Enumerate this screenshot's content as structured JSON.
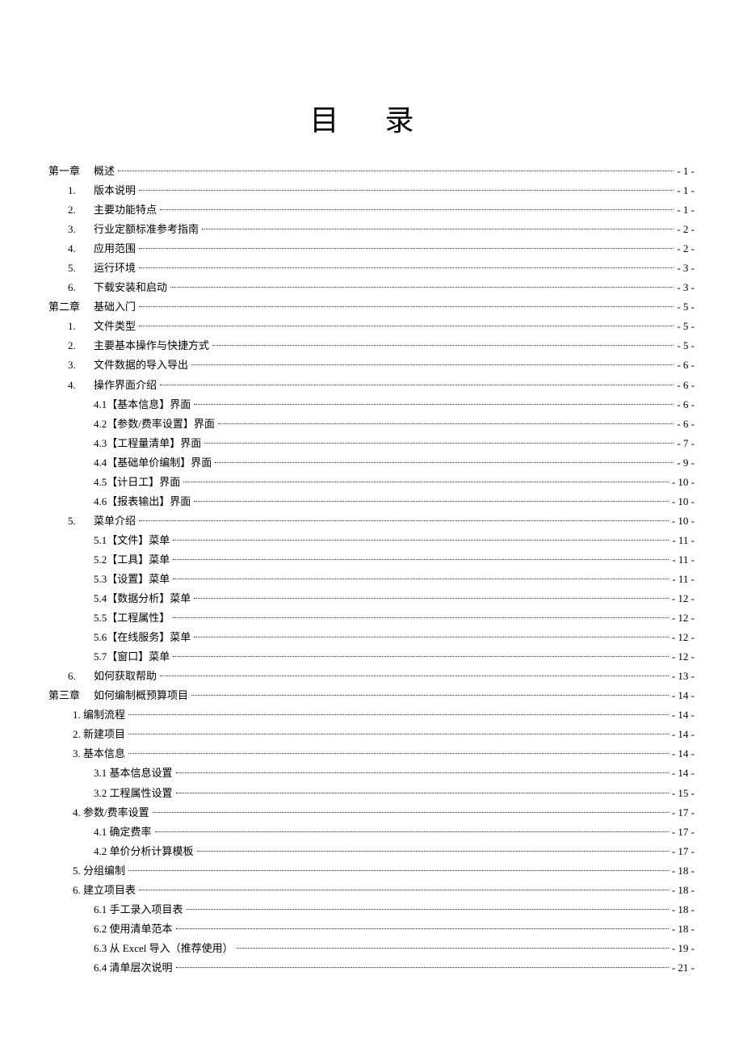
{
  "title": "目 录",
  "entries": [
    {
      "level": 0,
      "label": "第一章",
      "text": "概述",
      "page": "- 1 -"
    },
    {
      "level": 1,
      "label": "1.",
      "text": "版本说明",
      "page": "- 1 -"
    },
    {
      "level": 1,
      "label": "2.",
      "text": "主要功能特点",
      "page": "- 1 -"
    },
    {
      "level": 1,
      "label": "3.",
      "text": "行业定额标准参考指南",
      "page": "- 2 -"
    },
    {
      "level": 1,
      "label": "4.",
      "text": "应用范围",
      "page": "- 2 -"
    },
    {
      "level": 1,
      "label": "5.",
      "text": "运行环境",
      "page": "- 3 -"
    },
    {
      "level": 1,
      "label": "6.",
      "text": "下载安装和启动",
      "page": "- 3 -"
    },
    {
      "level": 0,
      "label": "第二章",
      "text": "基础入门",
      "page": "- 5 -"
    },
    {
      "level": 1,
      "label": "1.",
      "text": "文件类型",
      "page": "- 5 -"
    },
    {
      "level": 1,
      "label": "2.",
      "text": "主要基本操作与快捷方式",
      "page": "- 5 -"
    },
    {
      "level": 1,
      "label": "3.",
      "text": "文件数据的导入导出",
      "page": "- 6 -"
    },
    {
      "level": 1,
      "label": "4.",
      "text": "操作界面介绍",
      "page": "- 6 -"
    },
    {
      "level": 2,
      "label": "",
      "text": "4.1【基本信息】界面",
      "page": "- 6 -"
    },
    {
      "level": 2,
      "label": "",
      "text": "4.2【参数/费率设置】界面",
      "page": "- 6 -"
    },
    {
      "level": 2,
      "label": "",
      "text": "4.3【工程量清单】界面",
      "page": "- 7 -"
    },
    {
      "level": 2,
      "label": "",
      "text": "4.4【基础单价编制】界面",
      "page": "- 9 -"
    },
    {
      "level": 2,
      "label": "",
      "text": "4.5【计日工】界面",
      "page": "- 10 -"
    },
    {
      "level": 2,
      "label": "",
      "text": "4.6【报表输出】界面",
      "page": "- 10 -"
    },
    {
      "level": 1,
      "label": "5.",
      "text": "菜单介绍",
      "page": "- 10 -"
    },
    {
      "level": 2,
      "label": "",
      "text": "5.1【文件】菜单",
      "page": "- 11 -"
    },
    {
      "level": 2,
      "label": "",
      "text": "5.2【工具】菜单",
      "page": "- 11 -"
    },
    {
      "level": 2,
      "label": "",
      "text": "5.3【设置】菜单",
      "page": "- 11 -"
    },
    {
      "level": 2,
      "label": "",
      "text": "5.4【数据分析】菜单",
      "page": "- 12 -"
    },
    {
      "level": 2,
      "label": "",
      "text": "5.5【工程属性】",
      "page": "- 12 -"
    },
    {
      "level": 2,
      "label": "",
      "text": "5.6【在线服务】菜单",
      "page": "- 12 -"
    },
    {
      "level": 2,
      "label": "",
      "text": "5.7【窗口】菜单",
      "page": "- 12 -"
    },
    {
      "level": 1,
      "label": "6.",
      "text": "如何获取帮助",
      "page": "- 13 -"
    },
    {
      "level": 0,
      "label": "第三章",
      "text": "如何编制概预算项目",
      "page": "- 14 -"
    },
    {
      "level": "1b",
      "label": "",
      "text": "1. 编制流程",
      "page": "- 14 -"
    },
    {
      "level": "1b",
      "label": "",
      "text": "2. 新建项目",
      "page": "- 14 -"
    },
    {
      "level": "1b",
      "label": "",
      "text": "3. 基本信息",
      "page": "- 14 -"
    },
    {
      "level": "2b",
      "label": "",
      "text": "3.1 基本信息设置",
      "page": "- 14 -"
    },
    {
      "level": "2b",
      "label": "",
      "text": "3.2 工程属性设置",
      "page": "- 15 -"
    },
    {
      "level": "1b",
      "label": "",
      "text": "4. 参数/费率设置",
      "page": "- 17 -"
    },
    {
      "level": "2b",
      "label": "",
      "text": "4.1 确定费率",
      "page": "- 17 -"
    },
    {
      "level": "2b",
      "label": "",
      "text": "4.2 单价分析计算模板",
      "page": "- 17 -"
    },
    {
      "level": "1b",
      "label": "",
      "text": "5. 分组编制",
      "page": "- 18 -"
    },
    {
      "level": "1b",
      "label": "",
      "text": "6. 建立项目表",
      "page": "- 18 -"
    },
    {
      "level": "2b",
      "label": "",
      "text": "6.1 手工录入项目表",
      "page": "- 18 -"
    },
    {
      "level": "2b",
      "label": "",
      "text": "6.2 使用清单范本",
      "page": "- 18 -"
    },
    {
      "level": "2b",
      "label": "",
      "text": "6.3 从 Excel 导入（推荐使用）",
      "page": "- 19 -"
    },
    {
      "level": "2b",
      "label": "",
      "text": "6.4 清单层次说明",
      "page": "- 21 -"
    }
  ]
}
